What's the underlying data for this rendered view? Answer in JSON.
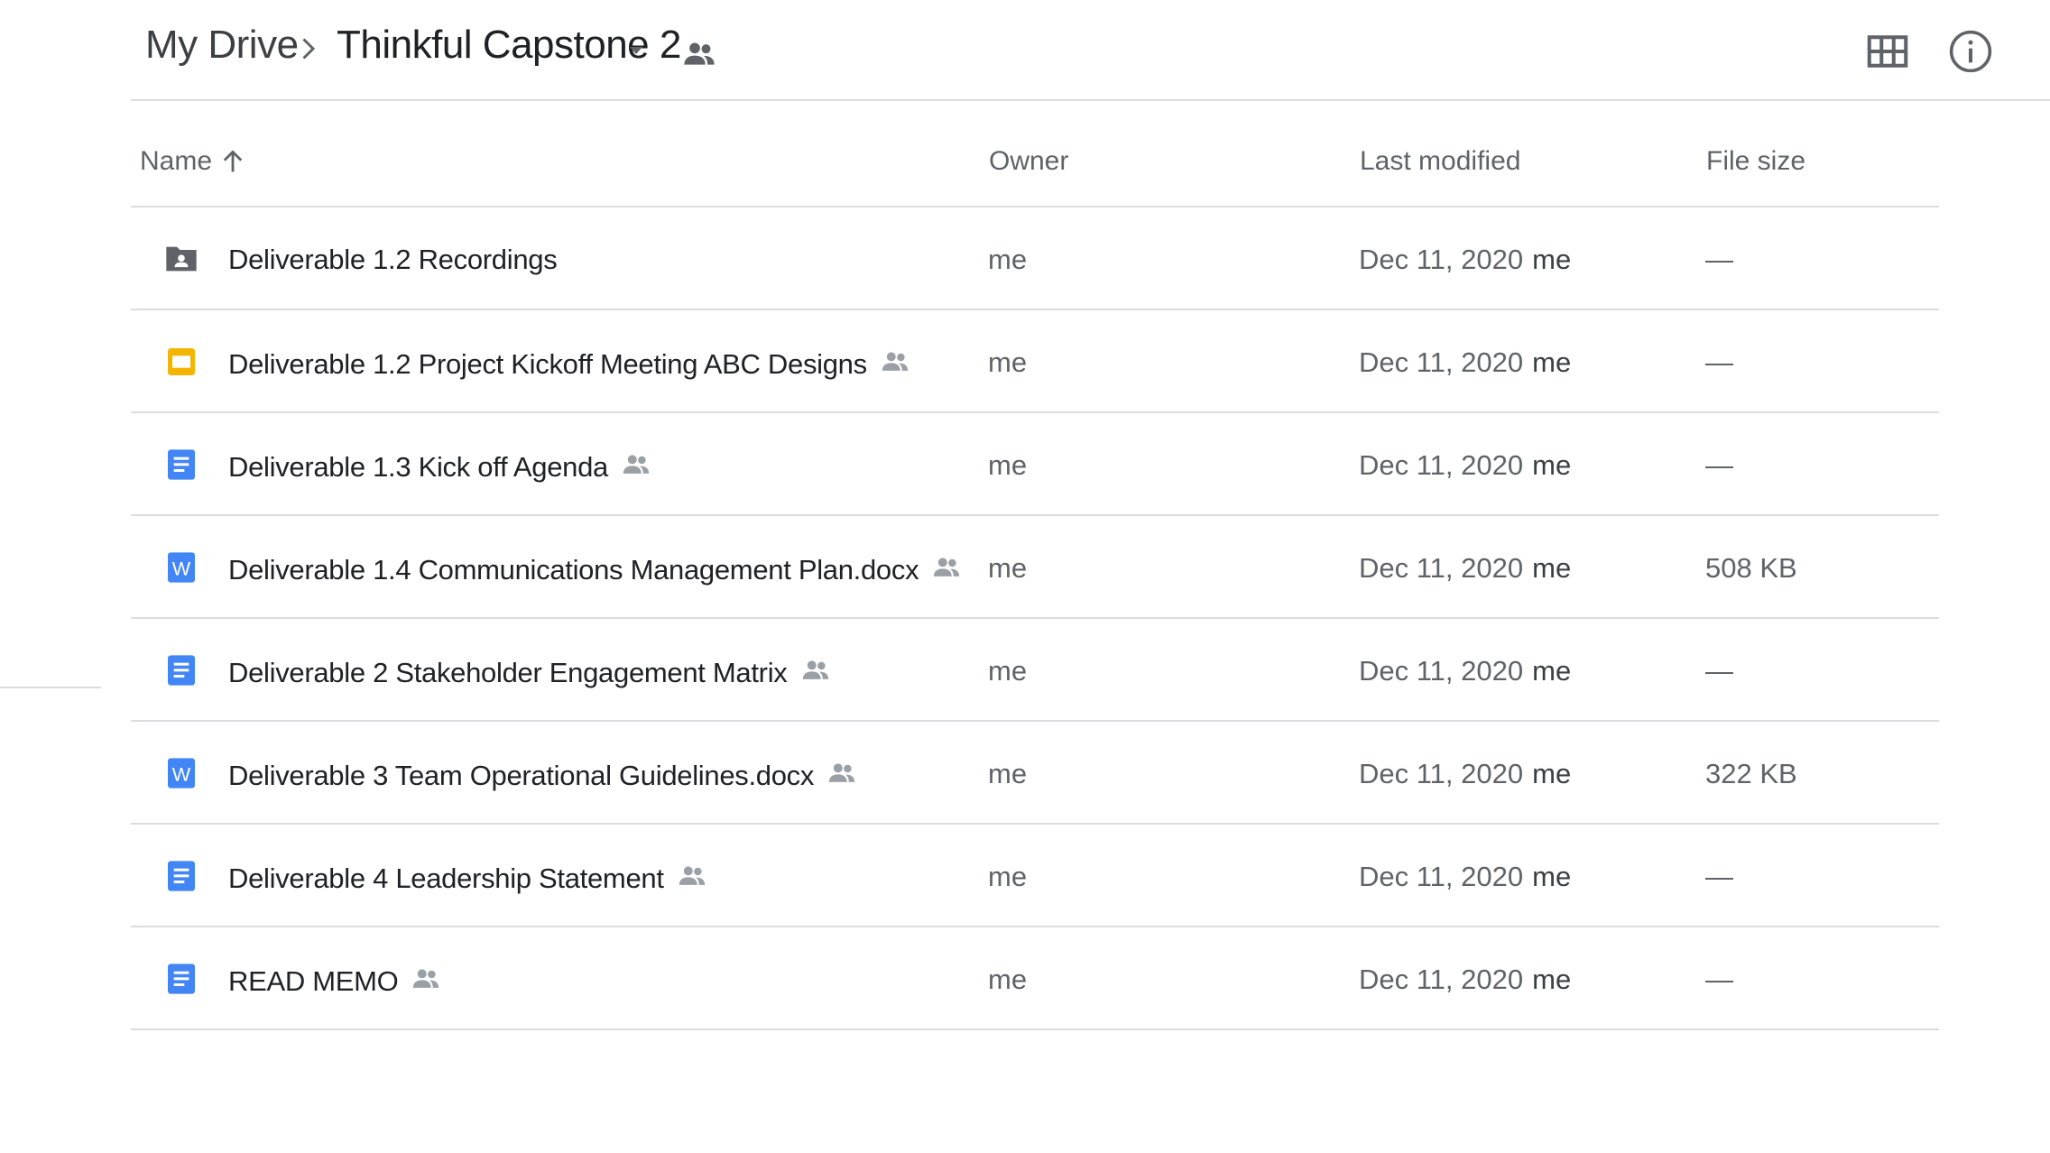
{
  "breadcrumb": {
    "root": "My Drive",
    "current": "Thinkful Capstone 2"
  },
  "icons": {
    "separator": "chevron-right-icon",
    "dropdown": "caret-down-icon",
    "shared": "people-icon",
    "grid": "grid-view-icon",
    "info": "info-icon",
    "sort": "arrow-up-icon"
  },
  "colors": {
    "docs_blue": "#4285f4",
    "slides_yellow": "#f4b400",
    "folder_gray": "#5f6368",
    "divider": "#dadce0"
  },
  "table": {
    "columns": {
      "name": "Name",
      "owner": "Owner",
      "modified": "Last modified",
      "size": "File size"
    },
    "rows": [
      {
        "type": "shared-folder",
        "name": "Deliverable 1.2 Recordings",
        "shared": false,
        "owner": "me",
        "modified": "Dec 11, 2020",
        "modified_by": "me",
        "size": "—"
      },
      {
        "type": "slides",
        "name": "Deliverable 1.2 Project Kickoff Meeting ABC Designs",
        "shared": true,
        "owner": "me",
        "modified": "Dec 11, 2020",
        "modified_by": "me",
        "size": "—"
      },
      {
        "type": "docs",
        "name": "Deliverable 1.3 Kick off Agenda",
        "shared": true,
        "owner": "me",
        "modified": "Dec 11, 2020",
        "modified_by": "me",
        "size": "—"
      },
      {
        "type": "word",
        "name": "Deliverable 1.4 Communications Management Plan.docx",
        "shared": true,
        "owner": "me",
        "modified": "Dec 11, 2020",
        "modified_by": "me",
        "size": "508 KB"
      },
      {
        "type": "docs",
        "name": "Deliverable 2 Stakeholder Engagement Matrix",
        "shared": true,
        "owner": "me",
        "modified": "Dec 11, 2020",
        "modified_by": "me",
        "size": "—"
      },
      {
        "type": "word",
        "name": "Deliverable 3 Team Operational Guidelines.docx",
        "shared": true,
        "owner": "me",
        "modified": "Dec 11, 2020",
        "modified_by": "me",
        "size": "322 KB"
      },
      {
        "type": "docs",
        "name": "Deliverable 4 Leadership Statement",
        "shared": true,
        "owner": "me",
        "modified": "Dec 11, 2020",
        "modified_by": "me",
        "size": "—"
      },
      {
        "type": "docs",
        "name": "READ MEMO",
        "shared": true,
        "owner": "me",
        "modified": "Dec 11, 2020",
        "modified_by": "me",
        "size": "—"
      }
    ]
  }
}
